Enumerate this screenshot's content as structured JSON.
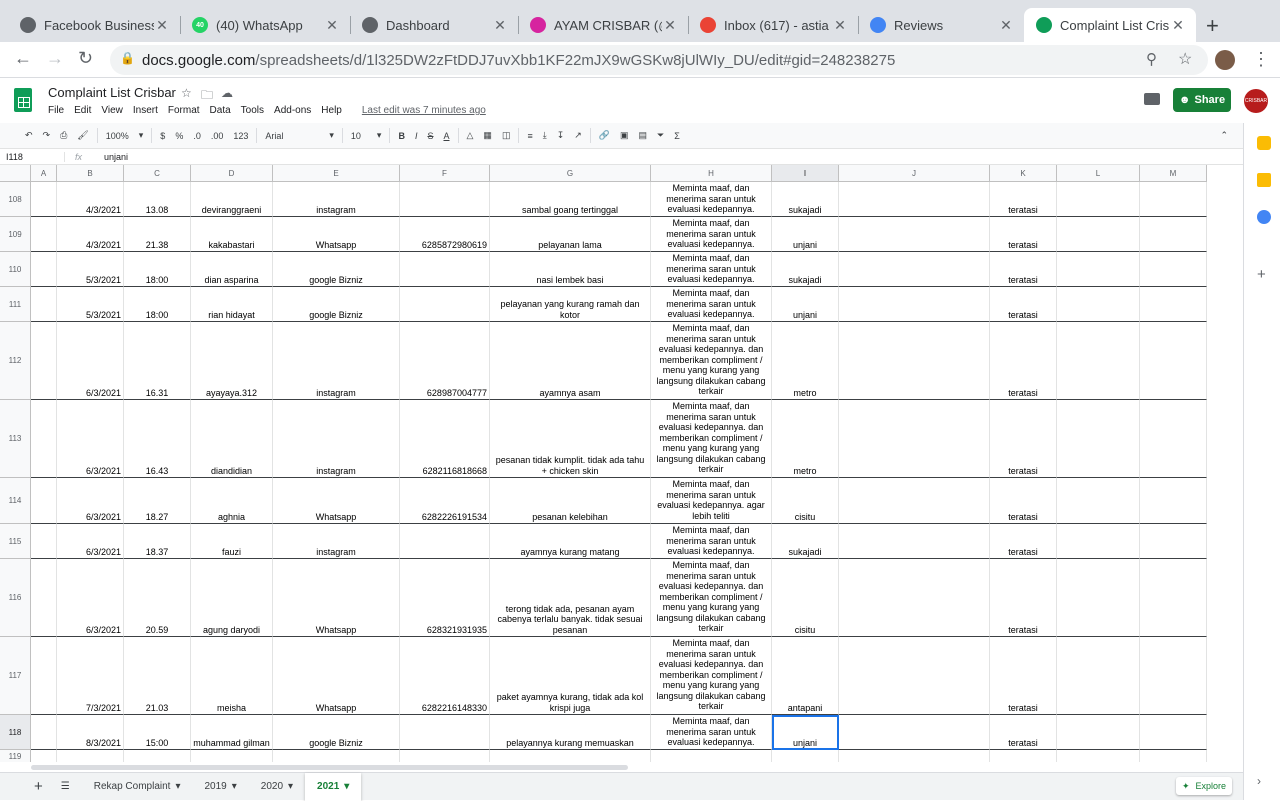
{
  "browser": {
    "tabs": [
      {
        "title": "Facebook Business",
        "icon": "facebook-icon",
        "color": "#5f6368"
      },
      {
        "title": "(40) WhatsApp",
        "icon": "whatsapp-icon",
        "color": "#25d366",
        "badge": "40"
      },
      {
        "title": "Dashboard",
        "icon": "globe-icon",
        "color": "#5f6368"
      },
      {
        "title": "AYAM CRISBAR (@",
        "icon": "instagram-icon",
        "color": "#d6249f"
      },
      {
        "title": "Inbox (617) - astia",
        "icon": "gmail-icon",
        "color": "#ea4335"
      },
      {
        "title": "Reviews",
        "icon": "reviews-icon",
        "color": "#4285f4"
      },
      {
        "title": "Complaint List Cris",
        "icon": "sheets-icon",
        "color": "#0f9d58",
        "active": true
      }
    ],
    "url_host": "docs.google.com",
    "url_path": "/spreadsheets/d/1l325DW2zFtDDJ7uvXbb1KF22mJX9wGSKw8jUlWIy_DU/edit#gid=248238275"
  },
  "doc": {
    "title": "Complaint List Crisbar",
    "menu": [
      "File",
      "Edit",
      "View",
      "Insert",
      "Format",
      "Data",
      "Tools",
      "Add-ons",
      "Help"
    ],
    "last_edit": "Last edit was 7 minutes ago",
    "share_label": "Share",
    "brand_label": "CRISBAR"
  },
  "toolbar": {
    "zoom": "100%",
    "currency": "$",
    "percent": "%",
    "dec_less": ".0",
    "dec_more": ".00",
    "format": "123",
    "font": "Arial",
    "size": "10"
  },
  "formula_bar": {
    "cell_ref": "I118",
    "fx": "fx",
    "value": "unjani"
  },
  "columns": [
    "A",
    "B",
    "C",
    "D",
    "E",
    "F",
    "G",
    "H",
    "I",
    "J",
    "K",
    "L",
    "M"
  ],
  "selected_column": "I",
  "rows": [
    {
      "n": "108",
      "b": "4/3/2021",
      "c": "13.08",
      "d": "deviranggraeni",
      "e": "instagram",
      "f": "",
      "g": "sambal goang tertinggal",
      "h": "Meminta maaf, dan menerima saran untuk evaluasi kedepannya.",
      "i": "sukajadi",
      "k": "teratasi"
    },
    {
      "n": "109",
      "b": "4/3/2021",
      "c": "21.38",
      "d": "kakabastari",
      "e": "Whatsapp",
      "f": "6285872980619",
      "g": "pelayanan lama",
      "h": "Meminta maaf, dan menerima saran untuk evaluasi kedepannya.",
      "i": "unjani",
      "k": "teratasi"
    },
    {
      "n": "110",
      "b": "5/3/2021",
      "c": "18:00",
      "d": "dian asparina",
      "e": "google Bizniz",
      "f": "",
      "g": "nasi lembek basi",
      "h": "Meminta maaf, dan menerima saran untuk evaluasi kedepannya.",
      "i": "sukajadi",
      "k": "teratasi"
    },
    {
      "n": "111",
      "b": "5/3/2021",
      "c": "18:00",
      "d": "rian hidayat",
      "e": "google Bizniz",
      "f": "",
      "g": "pelayanan yang kurang ramah dan kotor",
      "h": "Meminta maaf, dan menerima saran untuk evaluasi kedepannya.",
      "i": "unjani",
      "k": "teratasi"
    },
    {
      "n": "112",
      "b": "6/3/2021",
      "c": "16.31",
      "d": "ayayaya.312",
      "e": "instagram",
      "f": "628987004777",
      "g": "ayamnya asam",
      "h": "Meminta maaf, dan menerima saran untuk evaluasi kedepannya. dan memberikan compliment / menu yang kurang yang langsung dilakukan cabang terkair",
      "i": "metro",
      "k": "teratasi"
    },
    {
      "n": "113",
      "b": "6/3/2021",
      "c": "16.43",
      "d": "diandidian",
      "e": "instagram",
      "f": "6282116818668",
      "g": "pesanan tidak kumplit. tidak ada tahu + chicken skin",
      "h": "Meminta maaf, dan menerima saran untuk evaluasi kedepannya. dan memberikan compliment / menu yang kurang yang langsung dilakukan cabang terkair",
      "i": "metro",
      "k": "teratasi"
    },
    {
      "n": "114",
      "b": "6/3/2021",
      "c": "18.27",
      "d": "aghnia",
      "e": "Whatsapp",
      "f": "6282226191534",
      "g": "pesanan kelebihan",
      "h": "Meminta maaf, dan menerima saran untuk evaluasi kedepannya. agar lebih teliti",
      "i": "cisitu",
      "k": "teratasi"
    },
    {
      "n": "115",
      "b": "6/3/2021",
      "c": "18.37",
      "d": "fauzi",
      "e": "instagram",
      "f": "",
      "g": "ayamnya kurang matang",
      "h": "Meminta maaf, dan menerima saran untuk evaluasi kedepannya.",
      "i": "sukajadi",
      "k": "teratasi"
    },
    {
      "n": "116",
      "b": "6/3/2021",
      "c": "20.59",
      "d": "agung daryodi",
      "e": "Whatsapp",
      "f": "628321931935",
      "g": "terong tidak ada, pesanan ayam cabenya terlalu banyak. tidak sesuai pesanan",
      "h": "Meminta maaf, dan menerima saran untuk evaluasi kedepannya. dan memberikan compliment / menu yang kurang yang langsung dilakukan cabang terkair",
      "i": "cisitu",
      "k": "teratasi"
    },
    {
      "n": "117",
      "b": "7/3/2021",
      "c": "21.03",
      "d": "meisha",
      "e": "Whatsapp",
      "f": "6282216148330",
      "g": "paket ayamnya kurang, tidak ada kol krispi juga",
      "h": "Meminta maaf, dan menerima saran untuk evaluasi kedepannya. dan memberikan compliment / menu yang kurang yang langsung dilakukan cabang terkair",
      "i": "antapani",
      "k": "teratasi"
    },
    {
      "n": "118",
      "b": "8/3/2021",
      "c": "15:00",
      "d": "muhammad gilman",
      "e": "google Bizniz",
      "f": "",
      "g": "pelayannya kurang memuaskan",
      "h": "Meminta maaf, dan menerima saran untuk evaluasi kedepannya.",
      "i": "unjani",
      "k": "teratasi",
      "selected": true
    },
    {
      "n": "119",
      "b": "",
      "c": "",
      "d": "",
      "e": "",
      "f": "",
      "g": "",
      "h": "",
      "i": "",
      "k": ""
    }
  ],
  "sheet_tabs": [
    {
      "label": "Rekap Complaint"
    },
    {
      "label": "2019"
    },
    {
      "label": "2020"
    },
    {
      "label": "2021",
      "active": true
    }
  ],
  "explore_label": "Explore"
}
